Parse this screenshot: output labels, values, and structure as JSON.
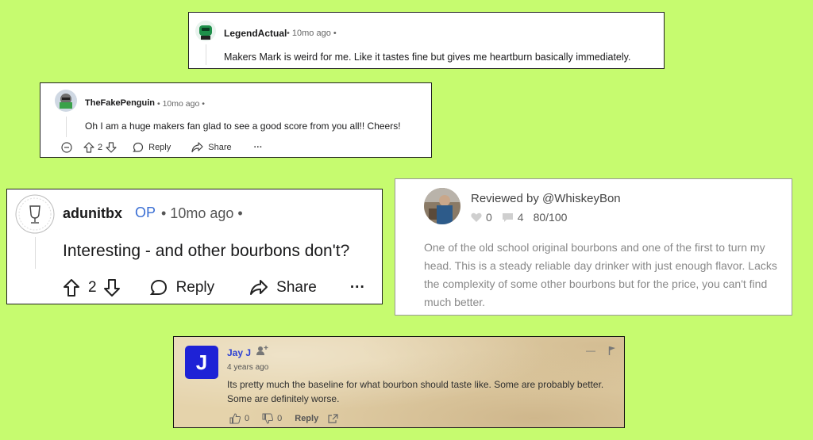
{
  "card1": {
    "username": "LegendActual",
    "meta": "• 10mo ago •",
    "body": "Makers Mark is weird for me. Like it tastes fine but gives me heartburn basically immediately."
  },
  "card2": {
    "username": "TheFakePenguin",
    "meta": "• 10mo ago •",
    "body": "Oh I am a huge makers fan glad to see a good score from you all!! Cheers!",
    "votes": "2",
    "reply_label": "Reply",
    "share_label": "Share",
    "more_label": "···"
  },
  "card3": {
    "username": "adunitbx",
    "op_badge": "OP",
    "meta": "• 10mo ago •",
    "body": "Interesting - and other bourbons don't?",
    "votes": "2",
    "reply_label": "Reply",
    "share_label": "Share",
    "more_label": "···"
  },
  "card4": {
    "reviewed_by": "Reviewed by @WhiskeyBon",
    "likes": "0",
    "comments": "4",
    "score": "80/100",
    "body": "One of the old school original bourbons and one of the first to turn my head. This is a steady reliable day drinker with just enough flavor. Lacks the complexity of some other bourbons but for the price, you can't find much better."
  },
  "card5": {
    "avatar_letter": "J",
    "username": "Jay J",
    "time": "4 years ago",
    "body": "Its pretty much the baseline for what bourbon should taste like. Some are probably better. Some are definitely worse.",
    "likes": "0",
    "dislikes": "0",
    "reply_label": "Reply",
    "collapse_label": "—",
    "colors": {
      "avatar_bg": "#1e22d6",
      "username": "#2a3fd4"
    }
  },
  "colors": {
    "page_bg": "#c6fb6f",
    "op_badge": "#3b6fd4"
  }
}
